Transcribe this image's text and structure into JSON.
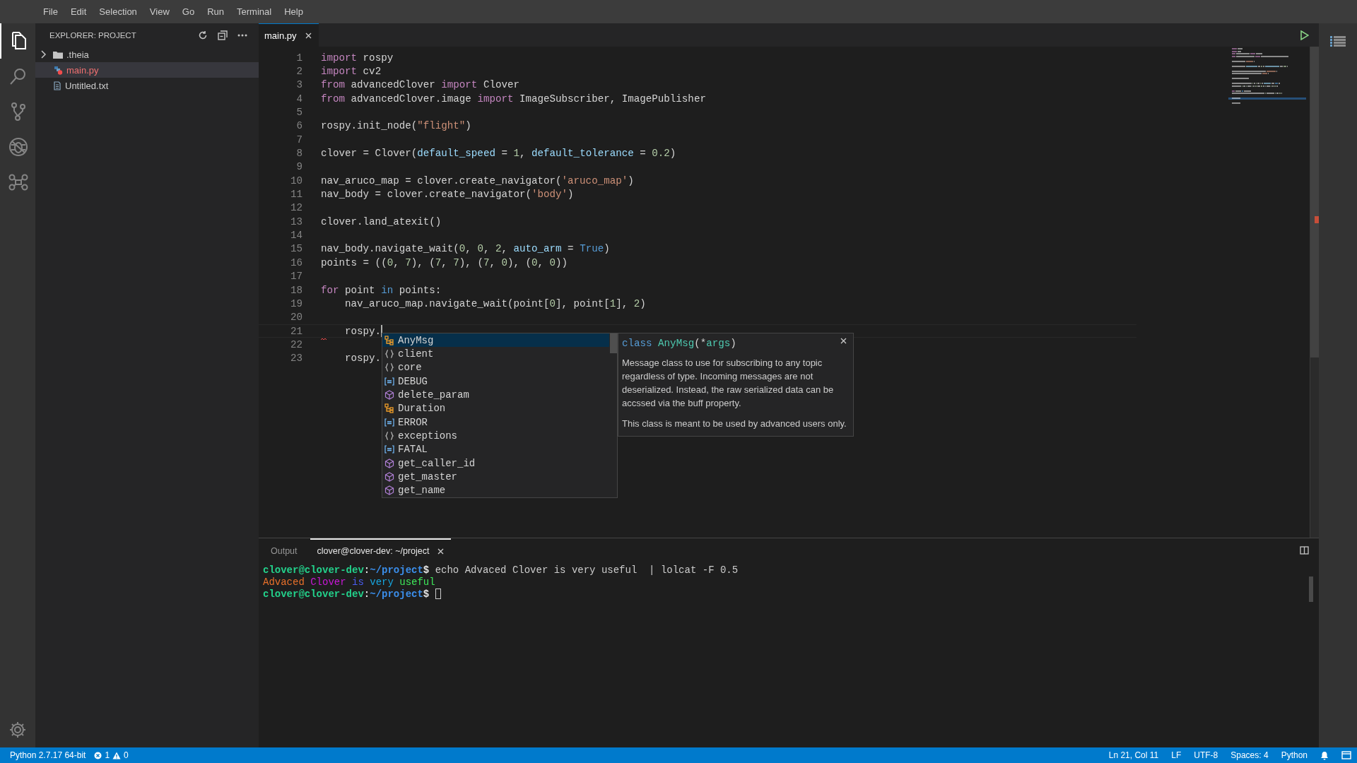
{
  "menu": [
    "File",
    "Edit",
    "Selection",
    "View",
    "Go",
    "Run",
    "Terminal",
    "Help"
  ],
  "activity_bar": [
    {
      "kind": "files",
      "selected": true
    },
    {
      "kind": "search",
      "selected": false
    },
    {
      "kind": "source-control",
      "selected": false
    },
    {
      "kind": "debug",
      "selected": false
    },
    {
      "kind": "drone",
      "selected": false
    }
  ],
  "explorer": {
    "title": "EXPLORER: PROJECT",
    "items": [
      {
        "kind": "folder",
        "name": ".theia",
        "expanded": false,
        "selected": false,
        "error": false
      },
      {
        "kind": "python",
        "name": "main.py",
        "selected": true,
        "error": true
      },
      {
        "kind": "text",
        "name": "Untitled.txt",
        "selected": false,
        "error": false
      }
    ]
  },
  "editor_tabs": [
    {
      "label": "main.py",
      "selected": true
    }
  ],
  "code": [
    {
      "number": "1",
      "current": false,
      "squiggle": false,
      "tokens": [
        {
          "kind": "kw",
          "text": "import"
        },
        {
          "kind": "plain",
          "text": " rospy"
        }
      ]
    },
    {
      "number": "2",
      "current": false,
      "squiggle": false,
      "tokens": [
        {
          "kind": "kw",
          "text": "import"
        },
        {
          "kind": "plain",
          "text": " cv2"
        }
      ]
    },
    {
      "number": "3",
      "current": false,
      "squiggle": false,
      "tokens": [
        {
          "kind": "kw",
          "text": "from"
        },
        {
          "kind": "plain",
          "text": " advancedClover "
        },
        {
          "kind": "kw",
          "text": "import"
        },
        {
          "kind": "plain",
          "text": " Clover"
        }
      ]
    },
    {
      "number": "4",
      "current": false,
      "squiggle": false,
      "tokens": [
        {
          "kind": "kw",
          "text": "from"
        },
        {
          "kind": "plain",
          "text": " advancedClover.image "
        },
        {
          "kind": "kw",
          "text": "import"
        },
        {
          "kind": "plain",
          "text": " ImageSubscriber, ImagePublisher"
        }
      ]
    },
    {
      "number": "5",
      "current": false,
      "squiggle": false
    },
    {
      "number": "6",
      "current": false,
      "squiggle": false,
      "tokens": [
        {
          "kind": "plain",
          "text": "rospy.init_node("
        },
        {
          "kind": "str",
          "text": "\"flight\""
        },
        {
          "kind": "plain",
          "text": ")"
        }
      ]
    },
    {
      "number": "7",
      "current": false,
      "squiggle": false
    },
    {
      "number": "8",
      "current": false,
      "squiggle": false,
      "tokens": [
        {
          "kind": "plain",
          "text": "clover = Clover("
        },
        {
          "kind": "param",
          "text": "default_speed"
        },
        {
          "kind": "plain",
          "text": " = "
        },
        {
          "kind": "num",
          "text": "1"
        },
        {
          "kind": "plain",
          "text": ", "
        },
        {
          "kind": "param",
          "text": "default_tolerance"
        },
        {
          "kind": "plain",
          "text": " = "
        },
        {
          "kind": "num",
          "text": "0.2"
        },
        {
          "kind": "plain",
          "text": ")"
        }
      ]
    },
    {
      "number": "9",
      "current": false,
      "squiggle": false
    },
    {
      "number": "10",
      "current": false,
      "squiggle": false,
      "tokens": [
        {
          "kind": "plain",
          "text": "nav_aruco_map = clover.create_navigator("
        },
        {
          "kind": "str",
          "text": "'aruco_map'"
        },
        {
          "kind": "plain",
          "text": ")"
        }
      ]
    },
    {
      "number": "11",
      "current": false,
      "squiggle": false,
      "tokens": [
        {
          "kind": "plain",
          "text": "nav_body = clover.create_navigator("
        },
        {
          "kind": "str",
          "text": "'body'"
        },
        {
          "kind": "plain",
          "text": ")"
        }
      ]
    },
    {
      "number": "12",
      "current": false,
      "squiggle": false
    },
    {
      "number": "13",
      "current": false,
      "squiggle": false,
      "tokens": [
        {
          "kind": "plain",
          "text": "clover.land_atexit()"
        }
      ]
    },
    {
      "number": "14",
      "current": false,
      "squiggle": false
    },
    {
      "number": "15",
      "current": false,
      "squiggle": false,
      "tokens": [
        {
          "kind": "plain",
          "text": "nav_body.navigate_wait("
        },
        {
          "kind": "num",
          "text": "0"
        },
        {
          "kind": "plain",
          "text": ", "
        },
        {
          "kind": "num",
          "text": "0"
        },
        {
          "kind": "plain",
          "text": ", "
        },
        {
          "kind": "num",
          "text": "2"
        },
        {
          "kind": "plain",
          "text": ", "
        },
        {
          "kind": "param",
          "text": "auto_arm"
        },
        {
          "kind": "plain",
          "text": " = "
        },
        {
          "kind": "const",
          "text": "True"
        },
        {
          "kind": "plain",
          "text": ")"
        }
      ]
    },
    {
      "number": "16",
      "current": false,
      "squiggle": false,
      "tokens": [
        {
          "kind": "plain",
          "text": "points = (("
        },
        {
          "kind": "num",
          "text": "0"
        },
        {
          "kind": "plain",
          "text": ", "
        },
        {
          "kind": "num",
          "text": "7"
        },
        {
          "kind": "plain",
          "text": "), ("
        },
        {
          "kind": "num",
          "text": "7"
        },
        {
          "kind": "plain",
          "text": ", "
        },
        {
          "kind": "num",
          "text": "7"
        },
        {
          "kind": "plain",
          "text": "), ("
        },
        {
          "kind": "num",
          "text": "7"
        },
        {
          "kind": "plain",
          "text": ", "
        },
        {
          "kind": "num",
          "text": "0"
        },
        {
          "kind": "plain",
          "text": "), ("
        },
        {
          "kind": "num",
          "text": "0"
        },
        {
          "kind": "plain",
          "text": ", "
        },
        {
          "kind": "num",
          "text": "0"
        },
        {
          "kind": "plain",
          "text": "))"
        }
      ]
    },
    {
      "number": "17",
      "current": false,
      "squiggle": false
    },
    {
      "number": "18",
      "current": false,
      "squiggle": false,
      "tokens": [
        {
          "kind": "kw",
          "text": "for"
        },
        {
          "kind": "plain",
          "text": " point "
        },
        {
          "kind": "const",
          "text": "in"
        },
        {
          "kind": "plain",
          "text": " points:"
        }
      ]
    },
    {
      "number": "19",
      "current": false,
      "squiggle": false,
      "tokens": [
        {
          "kind": "plain",
          "text": "    nav_aruco_map.navigate_wait(point["
        },
        {
          "kind": "num",
          "text": "0"
        },
        {
          "kind": "plain",
          "text": "], point["
        },
        {
          "kind": "num",
          "text": "1"
        },
        {
          "kind": "plain",
          "text": "], "
        },
        {
          "kind": "num",
          "text": "2"
        },
        {
          "kind": "plain",
          "text": ")"
        }
      ]
    },
    {
      "number": "20",
      "current": false,
      "squiggle": false
    },
    {
      "number": "21",
      "current": true,
      "squiggle": false,
      "tokens": [
        {
          "kind": "plain",
          "text": "    rospy."
        }
      ]
    },
    {
      "number": "22",
      "current": false,
      "squiggle": true
    },
    {
      "number": "23",
      "current": false,
      "squiggle": false,
      "tokens": [
        {
          "kind": "plain",
          "text": "    rospy."
        }
      ]
    }
  ],
  "suggestions": [
    {
      "kind": "class",
      "label": "AnyMsg",
      "selected": true
    },
    {
      "kind": "module",
      "label": "client",
      "selected": false
    },
    {
      "kind": "module",
      "label": "core",
      "selected": false
    },
    {
      "kind": "constant",
      "label": "DEBUG",
      "selected": false
    },
    {
      "kind": "method",
      "label": "delete_param",
      "selected": false
    },
    {
      "kind": "class",
      "label": "Duration",
      "selected": false
    },
    {
      "kind": "constant",
      "label": "ERROR",
      "selected": false
    },
    {
      "kind": "module",
      "label": "exceptions",
      "selected": false
    },
    {
      "kind": "constant",
      "label": "FATAL",
      "selected": false
    },
    {
      "kind": "method",
      "label": "get_caller_id",
      "selected": false
    },
    {
      "kind": "method",
      "label": "get_master",
      "selected": false
    },
    {
      "kind": "method",
      "label": "get_name",
      "selected": false
    }
  ],
  "details": {
    "signature": [
      {
        "kind": "const",
        "text": "class"
      },
      {
        "kind": "type",
        "text": "AnyMsg"
      },
      {
        "kind": "plain",
        "text": "(*"
      },
      {
        "kind": "type",
        "text": "args"
      },
      {
        "kind": "plain",
        "text": ")"
      }
    ],
    "paragraphs": [
      "Message class to use for subscribing to any topic regardless of type. Incoming messages are not deserialized. Instead, the raw serialized data can be accssed via the buff property.",
      "This class is meant to be used by advanced users only."
    ]
  },
  "panel_tabs": [
    {
      "label": "Output",
      "selected": false
    },
    {
      "label": "clover@clover-dev: ~/project",
      "selected": true
    }
  ],
  "terminal": [
    {
      "tokens": [
        {
          "color": "#23d18b",
          "bold": true,
          "text": "clover@clover-dev"
        },
        {
          "color": "#e5e5e5",
          "bold": true,
          "text": ":"
        },
        {
          "color": "#3b8eea",
          "bold": true,
          "text": "~/project"
        },
        {
          "color": "#e5e5e5",
          "bold": true,
          "text": "$"
        },
        {
          "color": "#cccccc",
          "bold": false,
          "text": " echo Advaced Clover is very useful  | lolcat -F 0.5"
        }
      ],
      "cursor": false
    },
    {
      "tokens": [
        {
          "color": "#e8702a",
          "bold": false,
          "text": "Advaced "
        },
        {
          "color": "#c918d8",
          "bold": false,
          "text": "Clover "
        },
        {
          "color": "#4a5cf0",
          "bold": false,
          "text": "is "
        },
        {
          "color": "#16a6e0",
          "bold": false,
          "text": "very "
        },
        {
          "color": "#3ee85a",
          "bold": false,
          "text": "useful"
        }
      ],
      "cursor": false
    },
    {
      "tokens": [
        {
          "color": "#23d18b",
          "bold": true,
          "text": "clover@clover-dev"
        },
        {
          "color": "#e5e5e5",
          "bold": true,
          "text": ":"
        },
        {
          "color": "#3b8eea",
          "bold": true,
          "text": "~/project"
        },
        {
          "color": "#e5e5e5",
          "bold": true,
          "text": "$"
        }
      ],
      "cursor": true
    }
  ],
  "status_bar": {
    "interpreter": "Python 2.7.17 64-bit",
    "errors": "1",
    "warnings": "0",
    "right": [
      "Ln 21, Col 11",
      "LF",
      "UTF-8",
      "Spaces: 4",
      "Python"
    ]
  }
}
